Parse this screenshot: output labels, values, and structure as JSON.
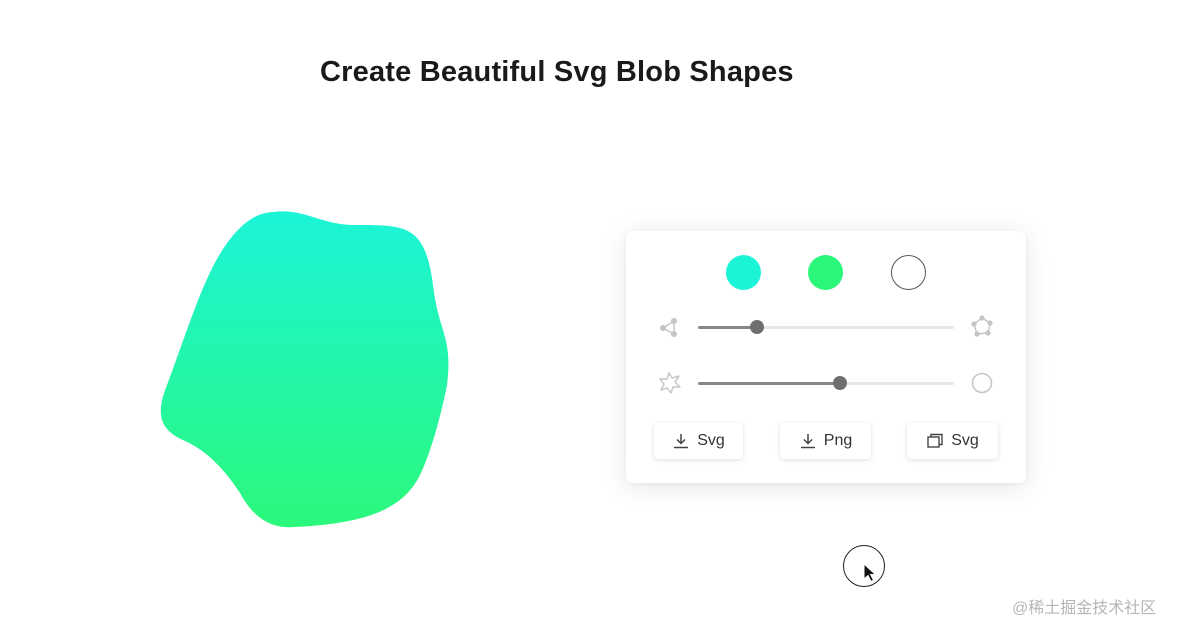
{
  "header": {
    "title": "Create Beautiful Svg Blob Shapes"
  },
  "blob": {
    "gradient_top": "#1cf4d8",
    "gradient_bottom": "#2bf87a"
  },
  "controls": {
    "colors": [
      {
        "name": "gradient-start",
        "value": "#1cf4d8"
      },
      {
        "name": "gradient-end",
        "value": "#2bf87a"
      },
      {
        "name": "outline",
        "value": "#ffffff"
      }
    ],
    "sliders": [
      {
        "name": "complexity",
        "left_icon": "nodes-few-icon",
        "right_icon": "nodes-many-icon",
        "level": 0.23
      },
      {
        "name": "randomness",
        "left_icon": "splat-icon",
        "right_icon": "circle-icon",
        "level": 0.555
      }
    ],
    "buttons": [
      {
        "icon": "download-icon",
        "label": "Svg"
      },
      {
        "icon": "download-icon",
        "label": "Png"
      },
      {
        "icon": "copy-icon",
        "label": "Svg"
      }
    ]
  },
  "watermark": "@稀土掘金技术社区"
}
